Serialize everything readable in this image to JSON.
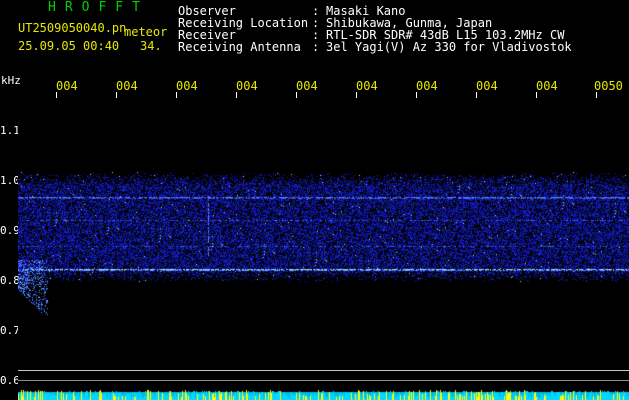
{
  "brand": "HROFFT",
  "file": {
    "name": "UT2509050040.pn",
    "type": "meteor",
    "datetime": "25.09.05 00:40",
    "count": "34."
  },
  "info": [
    {
      "label": "Observer",
      "value": "Masaki Kano"
    },
    {
      "label": "Receiving Location",
      "value": "Shibukawa, Gunma, Japan"
    },
    {
      "label": "Receiver",
      "value": "RTL-SDR SDR# 43dB L15 103.2MHz CW"
    },
    {
      "label": "Receiving Antenna",
      "value": "3el Yagi(V) Az 330 for Vladivostok"
    }
  ],
  "axis": {
    "unit": "kHz",
    "y_ticks": [
      "1.1",
      "1.0",
      "0.9",
      "0.8",
      "0.7",
      "0.6"
    ],
    "x_ticks": [
      "004",
      "004",
      "004",
      "004",
      "004",
      "004",
      "004",
      "004",
      "004",
      "0050"
    ]
  },
  "colors": {
    "background": "#000000",
    "brand": "#00d000",
    "header_text": "#ffffff",
    "time_ticks": "#e8e800",
    "signal": "#2040ff",
    "echo_line": "#a0d0ff",
    "bottom_bar": "#00d8ff",
    "bottom_spike": "#ffff00"
  }
}
